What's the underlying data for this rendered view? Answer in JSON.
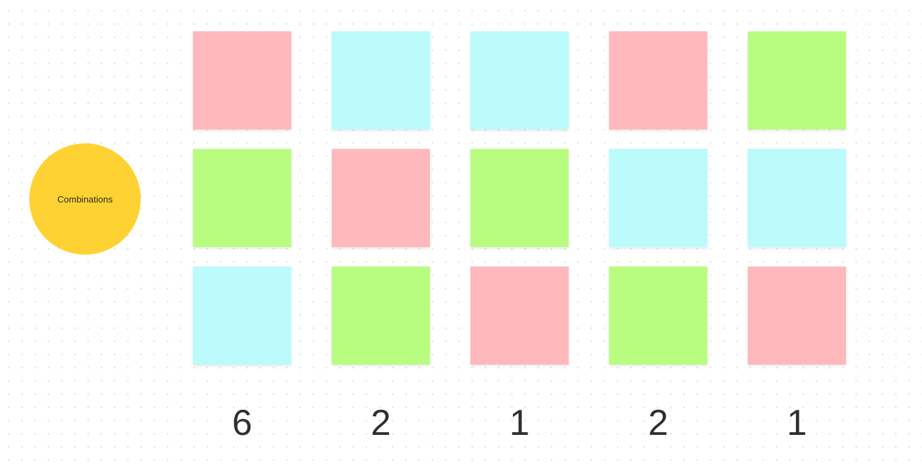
{
  "colors": {
    "pink": "#ffb8bc",
    "cyan": "#bbfbfc",
    "green": "#b8fd80",
    "yellow": "#ffd233",
    "text": "#2f2f2f"
  },
  "center_label": "Combinations",
  "columns": [
    {
      "notes": [
        "pink",
        "green",
        "cyan"
      ],
      "count": "6"
    },
    {
      "notes": [
        "cyan",
        "pink",
        "green"
      ],
      "count": "2"
    },
    {
      "notes": [
        "cyan",
        "green",
        "pink"
      ],
      "count": "1"
    },
    {
      "notes": [
        "pink",
        "cyan",
        "green"
      ],
      "count": "2"
    },
    {
      "notes": [
        "green",
        "cyan",
        "pink"
      ],
      "count": "1"
    }
  ]
}
